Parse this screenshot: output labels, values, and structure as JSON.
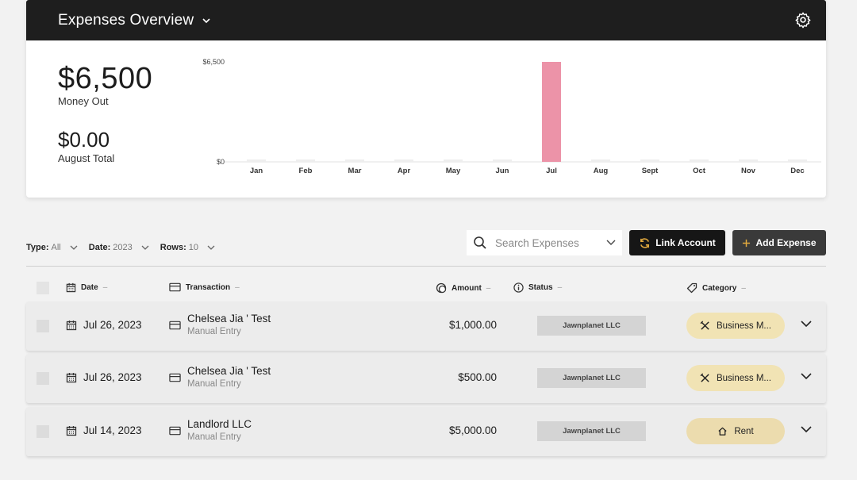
{
  "header": {
    "title": "Expenses Overview"
  },
  "kpis": {
    "money_out_value": "$6,500",
    "money_out_label": "Money Out",
    "month_total_value": "$0.00",
    "month_total_label": "August Total"
  },
  "chart_data": {
    "type": "bar",
    "categories": [
      "Jan",
      "Feb",
      "Mar",
      "Apr",
      "May",
      "Jun",
      "Jul",
      "Aug",
      "Sept",
      "Oct",
      "Nov",
      "Dec"
    ],
    "values": [
      0,
      0,
      0,
      0,
      0,
      0,
      6500,
      0,
      0,
      0,
      0,
      0
    ],
    "y_tick_labels": [
      "$0",
      "$6,500"
    ],
    "ylim": [
      0,
      6500
    ],
    "bar_color": "#ec93a8",
    "empty_bar_color": "#eeeeee",
    "grid": false
  },
  "filters": {
    "type_label": "Type:",
    "type_value": "All",
    "date_label": "Date:",
    "date_value": "2023",
    "rows_label": "Rows:",
    "rows_value": "10"
  },
  "search": {
    "placeholder": "Search Expenses"
  },
  "actions": {
    "link_account": "Link Account",
    "add_expense": "Add Expense"
  },
  "table": {
    "columns": {
      "date": "Date",
      "transaction": "Transaction",
      "amount": "Amount",
      "status": "Status",
      "category": "Category",
      "sort_marker": "–"
    },
    "rows": [
      {
        "date": "Jul 26, 2023",
        "name": "Chelsea Jia ' Test",
        "source": "Manual Entry",
        "amount": "$1,000.00",
        "status": "Jawnplanet LLC",
        "category": "Business M...",
        "category_icon": "utensils-icon",
        "category_color": "#f1e3b4"
      },
      {
        "date": "Jul 26, 2023",
        "name": "Chelsea Jia ' Test",
        "source": "Manual Entry",
        "amount": "$500.00",
        "status": "Jawnplanet LLC",
        "category": "Business M...",
        "category_icon": "utensils-icon",
        "category_color": "#f1e3b4"
      },
      {
        "date": "Jul 14, 2023",
        "name": "Landlord LLC",
        "source": "Manual Entry",
        "amount": "$5,000.00",
        "status": "Jawnplanet LLC",
        "category": "Rent",
        "category_icon": "house-icon",
        "category_color": "#ecdcae"
      }
    ]
  },
  "colors": {
    "header_bg": "#1e1e1e",
    "accent_gold": "#d9a441",
    "bar_pink": "#ec93a8"
  }
}
